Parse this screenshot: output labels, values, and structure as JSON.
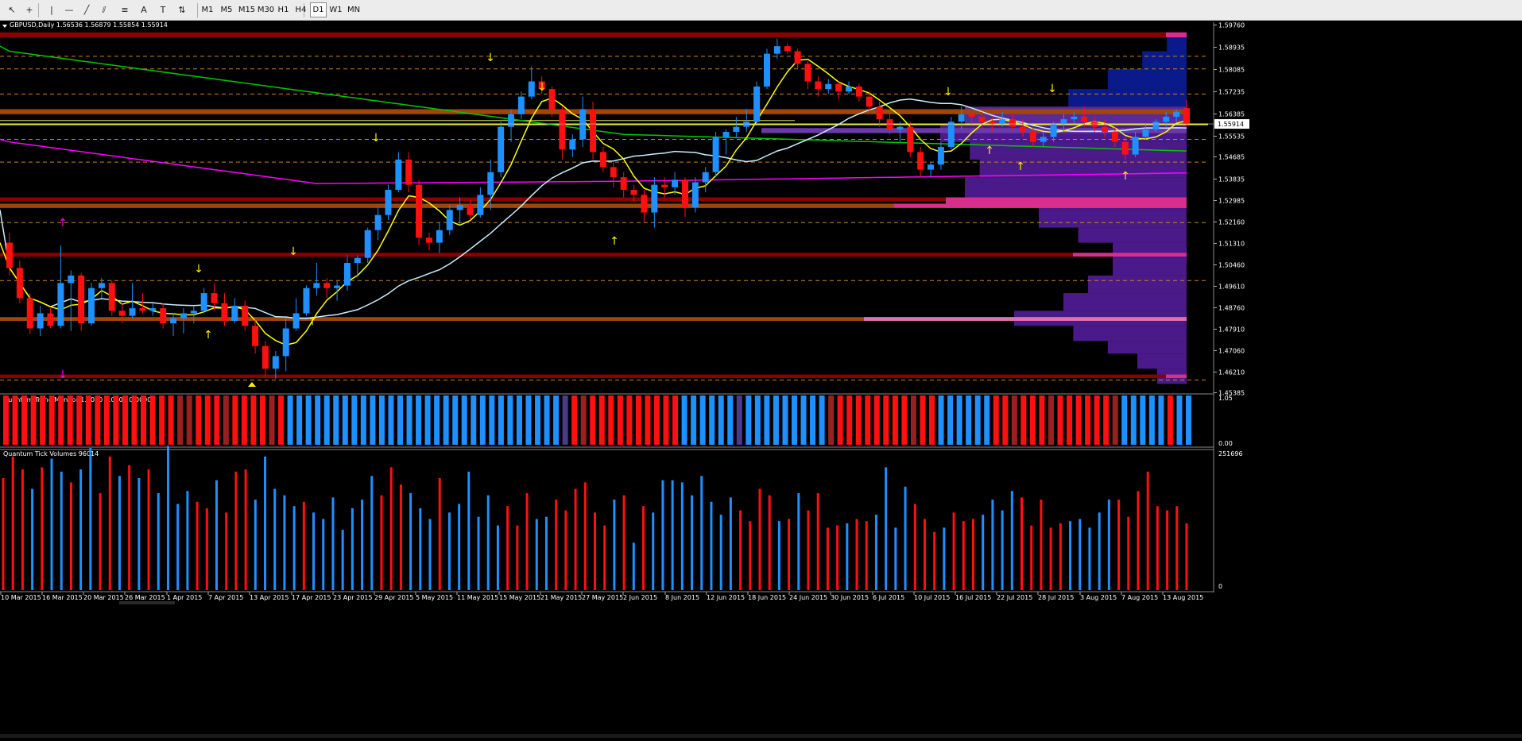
{
  "toolbar": {
    "tools": [
      {
        "name": "cursor-icon",
        "glyph": "↖"
      },
      {
        "name": "crosshair-icon",
        "glyph": "+"
      },
      {
        "name": "vertical-line-icon",
        "glyph": "|"
      },
      {
        "name": "horizontal-line-icon",
        "glyph": "—"
      },
      {
        "name": "trendline-icon",
        "glyph": "╱"
      },
      {
        "name": "equidistant-channel-icon",
        "glyph": "⫽"
      },
      {
        "name": "fibonacci-icon",
        "glyph": "≡"
      },
      {
        "name": "text-icon",
        "glyph": "A"
      },
      {
        "name": "text-label-icon",
        "glyph": "T"
      },
      {
        "name": "arrows-icon",
        "glyph": "⇅"
      }
    ],
    "timeframes": [
      "M1",
      "M5",
      "M15",
      "M30",
      "H1",
      "H4",
      "D1",
      "W1",
      "MN"
    ],
    "active_timeframe": "D1"
  },
  "main_chart": {
    "title": "GBPUSD,Daily  1.56536 1.56879 1.55854 1.55914",
    "current_price": "1.55914",
    "price_labels": [
      "1.59760",
      "1.58935",
      "1.58085",
      "1.57235",
      "1.56385",
      "1.55535",
      "1.54685",
      "1.53835",
      "1.52985",
      "1.52160",
      "1.51310",
      "1.50460",
      "1.49610",
      "1.48760",
      "1.47910",
      "1.47060",
      "1.46210",
      "1.45385"
    ]
  },
  "trend_monitor": {
    "title": "Quantum Trend Monitor 1.0000 0.0000 0.0000",
    "scale_top": "1.05",
    "scale_bottom": "0.00"
  },
  "tick_volumes": {
    "title": "Quantum Tick Volumes 96014",
    "scale_top": "251696",
    "scale_bottom": "0"
  },
  "date_labels": [
    "10 Mar 2015",
    "16 Mar 2015",
    "20 Mar 2015",
    "26 Mar 2015",
    "1 Apr 2015",
    "7 Apr 2015",
    "13 Apr 2015",
    "17 Apr 2015",
    "23 Apr 2015",
    "29 Apr 2015",
    "5 May 2015",
    "11 May 2015",
    "15 May 2015",
    "21 May 2015",
    "27 May 2015",
    "2 Jun 2015",
    "8 Jun 2015",
    "12 Jun 2015",
    "18 Jun 2015",
    "24 Jun 2015",
    "30 Jun 2015",
    "6 Jul 2015",
    "10 Jul 2015",
    "16 Jul 2015",
    "22 Jul 2015",
    "28 Jul 2015",
    "3 Aug 2015",
    "7 Aug 2015",
    "13 Aug 2015"
  ],
  "colors": {
    "bull": "#1e90ff",
    "bear": "#ff1010",
    "dark_red_zone": "#8b0000",
    "orange_zone": "#a0460a",
    "yellow_line": "#ffff00",
    "green_ma": "#00c800",
    "magenta_ma": "#ff00ff",
    "light_blue_ma": "#c8f0ff",
    "profile_purple": "#4b1a8a",
    "profile_blue": "#0a1a8a",
    "profile_pink": "#d82e8c"
  },
  "candles": [
    [
      1.512,
      1.516,
      1.499,
      1.502
    ],
    [
      1.502,
      1.505,
      1.488,
      1.49
    ],
    [
      1.49,
      1.492,
      1.476,
      1.478
    ],
    [
      1.478,
      1.487,
      1.475,
      1.484
    ],
    [
      1.484,
      1.486,
      1.478,
      1.479
    ],
    [
      1.479,
      1.511,
      1.478,
      1.496
    ],
    [
      1.496,
      1.501,
      1.477,
      1.499
    ],
    [
      1.499,
      1.5,
      1.477,
      1.48
    ],
    [
      1.48,
      1.496,
      1.479,
      1.494
    ],
    [
      1.494,
      1.498,
      1.49,
      1.496
    ],
    [
      1.496,
      1.497,
      1.483,
      1.485
    ],
    [
      1.485,
      1.488,
      1.48,
      1.483
    ],
    [
      1.483,
      1.496,
      1.482,
      1.486
    ],
    [
      1.486,
      1.492,
      1.484,
      1.485
    ],
    [
      1.485,
      1.488,
      1.483,
      1.486
    ],
    [
      1.486,
      1.488,
      1.478,
      1.48
    ],
    [
      1.48,
      1.484,
      1.475,
      1.482
    ],
    [
      1.482,
      1.486,
      1.476,
      1.484
    ],
    [
      1.484,
      1.487,
      1.48,
      1.485
    ],
    [
      1.485,
      1.494,
      1.484,
      1.492
    ],
    [
      1.492,
      1.496,
      1.485,
      1.488
    ],
    [
      1.488,
      1.492,
      1.479,
      1.481
    ],
    [
      1.481,
      1.49,
      1.48,
      1.487
    ],
    [
      1.487,
      1.489,
      1.477,
      1.479
    ],
    [
      1.479,
      1.482,
      1.468,
      1.471
    ],
    [
      1.471,
      1.473,
      1.459,
      1.462
    ],
    [
      1.462,
      1.469,
      1.458,
      1.467
    ],
    [
      1.467,
      1.482,
      1.461,
      1.478
    ],
    [
      1.478,
      1.49,
      1.477,
      1.484
    ],
    [
      1.484,
      1.495,
      1.483,
      1.494
    ],
    [
      1.494,
      1.504,
      1.491,
      1.496
    ],
    [
      1.496,
      1.498,
      1.49,
      1.494
    ],
    [
      1.494,
      1.497,
      1.489,
      1.495
    ],
    [
      1.495,
      1.507,
      1.493,
      1.504
    ],
    [
      1.504,
      1.507,
      1.499,
      1.506
    ],
    [
      1.506,
      1.518,
      1.504,
      1.517
    ],
    [
      1.517,
      1.526,
      1.513,
      1.523
    ],
    [
      1.523,
      1.535,
      1.521,
      1.533
    ],
    [
      1.533,
      1.548,
      1.532,
      1.545
    ],
    [
      1.545,
      1.548,
      1.532,
      1.535
    ],
    [
      1.535,
      1.537,
      1.511,
      1.514
    ],
    [
      1.514,
      1.516,
      1.509,
      1.512
    ],
    [
      1.512,
      1.52,
      1.508,
      1.517
    ],
    [
      1.517,
      1.527,
      1.515,
      1.525
    ],
    [
      1.525,
      1.53,
      1.519,
      1.527
    ],
    [
      1.527,
      1.529,
      1.521,
      1.523
    ],
    [
      1.523,
      1.534,
      1.522,
      1.531
    ],
    [
      1.531,
      1.545,
      1.525,
      1.54
    ],
    [
      1.54,
      1.56,
      1.538,
      1.558
    ],
    [
      1.558,
      1.565,
      1.552,
      1.563
    ],
    [
      1.563,
      1.572,
      1.561,
      1.57
    ],
    [
      1.57,
      1.582,
      1.569,
      1.576
    ],
    [
      1.576,
      1.578,
      1.571,
      1.573
    ],
    [
      1.573,
      1.574,
      1.562,
      1.565
    ],
    [
      1.565,
      1.566,
      1.545,
      1.549
    ],
    [
      1.549,
      1.555,
      1.546,
      1.553
    ],
    [
      1.553,
      1.57,
      1.55,
      1.565
    ],
    [
      1.565,
      1.568,
      1.545,
      1.548
    ],
    [
      1.548,
      1.55,
      1.54,
      1.542
    ],
    [
      1.542,
      1.544,
      1.534,
      1.538
    ],
    [
      1.538,
      1.54,
      1.53,
      1.533
    ],
    [
      1.533,
      1.535,
      1.528,
      1.531
    ],
    [
      1.531,
      1.533,
      1.52,
      1.524
    ],
    [
      1.524,
      1.538,
      1.518,
      1.535
    ],
    [
      1.535,
      1.538,
      1.53,
      1.534
    ],
    [
      1.534,
      1.54,
      1.531,
      1.537
    ],
    [
      1.537,
      1.538,
      1.522,
      1.526
    ],
    [
      1.526,
      1.538,
      1.524,
      1.536
    ],
    [
      1.536,
      1.542,
      1.532,
      1.54
    ],
    [
      1.54,
      1.556,
      1.538,
      1.554
    ],
    [
      1.554,
      1.557,
      1.547,
      1.556
    ],
    [
      1.556,
      1.562,
      1.554,
      1.558
    ],
    [
      1.558,
      1.565,
      1.556,
      1.56
    ],
    [
      1.56,
      1.576,
      1.559,
      1.574
    ],
    [
      1.574,
      1.589,
      1.573,
      1.587
    ],
    [
      1.587,
      1.593,
      1.585,
      1.59
    ],
    [
      1.59,
      1.591,
      1.587,
      1.588
    ],
    [
      1.588,
      1.589,
      1.581,
      1.583
    ],
    [
      1.583,
      1.584,
      1.573,
      1.576
    ],
    [
      1.576,
      1.578,
      1.57,
      1.573
    ],
    [
      1.573,
      1.577,
      1.571,
      1.575
    ],
    [
      1.575,
      1.576,
      1.569,
      1.572
    ],
    [
      1.572,
      1.576,
      1.571,
      1.574
    ],
    [
      1.574,
      1.575,
      1.568,
      1.57
    ],
    [
      1.57,
      1.572,
      1.564,
      1.566
    ],
    [
      1.566,
      1.568,
      1.558,
      1.561
    ],
    [
      1.561,
      1.563,
      1.555,
      1.557
    ],
    [
      1.557,
      1.56,
      1.552,
      1.558
    ],
    [
      1.558,
      1.56,
      1.546,
      1.548
    ],
    [
      1.548,
      1.55,
      1.538,
      1.541
    ],
    [
      1.541,
      1.544,
      1.538,
      1.543
    ],
    [
      1.543,
      1.552,
      1.541,
      1.55
    ],
    [
      1.55,
      1.562,
      1.549,
      1.56
    ],
    [
      1.56,
      1.566,
      1.557,
      1.563
    ],
    [
      1.563,
      1.565,
      1.559,
      1.562
    ],
    [
      1.562,
      1.564,
      1.557,
      1.56
    ],
    [
      1.56,
      1.562,
      1.556,
      1.559
    ],
    [
      1.559,
      1.564,
      1.558,
      1.561
    ],
    [
      1.561,
      1.563,
      1.556,
      1.558
    ],
    [
      1.558,
      1.561,
      1.554,
      1.556
    ],
    [
      1.556,
      1.558,
      1.55,
      1.552
    ],
    [
      1.552,
      1.556,
      1.55,
      1.554
    ],
    [
      1.554,
      1.56,
      1.552,
      1.559
    ],
    [
      1.559,
      1.563,
      1.556,
      1.561
    ],
    [
      1.561,
      1.564,
      1.559,
      1.562
    ],
    [
      1.562,
      1.566,
      1.558,
      1.56
    ],
    [
      1.56,
      1.562,
      1.556,
      1.558
    ],
    [
      1.558,
      1.561,
      1.554,
      1.556
    ],
    [
      1.556,
      1.558,
      1.55,
      1.552
    ],
    [
      1.552,
      1.554,
      1.545,
      1.547
    ],
    [
      1.547,
      1.556,
      1.546,
      1.554
    ],
    [
      1.554,
      1.559,
      1.553,
      1.557
    ],
    [
      1.557,
      1.561,
      1.556,
      1.56
    ],
    [
      1.56,
      1.564,
      1.558,
      1.562
    ],
    [
      1.562,
      1.565,
      1.56,
      1.564
    ],
    [
      1.5654,
      1.5688,
      1.5585,
      1.5591
    ]
  ],
  "trend_bars": [
    1,
    1,
    1,
    1,
    1,
    1,
    1,
    1,
    1,
    1,
    1,
    1,
    1,
    1,
    1,
    1,
    1,
    1,
    1,
    2,
    2,
    1,
    1,
    1,
    2,
    1,
    1,
    1,
    1,
    2,
    1,
    0,
    0,
    0,
    0,
    0,
    0,
    0,
    0,
    0,
    0,
    0,
    0,
    0,
    0,
    0,
    0,
    0,
    0,
    0,
    0,
    0,
    0,
    0,
    0,
    0,
    0,
    0,
    0,
    0,
    0,
    3,
    1,
    2,
    1,
    1,
    1,
    1,
    1,
    1,
    1,
    1,
    1,
    1,
    0,
    0,
    0,
    0,
    0,
    0,
    3,
    0,
    0,
    0,
    0,
    0,
    0,
    0,
    0,
    0,
    2,
    1,
    1,
    1,
    1,
    1,
    1,
    1,
    1,
    2,
    1,
    1,
    0,
    0,
    0,
    0,
    0,
    0,
    1,
    1,
    2,
    1,
    1,
    1,
    2,
    1,
    1,
    1,
    1,
    1,
    1,
    2,
    0,
    0,
    0,
    0,
    0,
    1,
    0,
    0
  ],
  "volumes": [
    0.52,
    0.62,
    0.56,
    0.47,
    0.57,
    0.61,
    0.55,
    0.5,
    0.56,
    0.66,
    0.45,
    0.62,
    0.53,
    0.58,
    0.52,
    0.56,
    0.45,
    0.67,
    0.4,
    0.46,
    0.41,
    0.38,
    0.51,
    0.36,
    0.55,
    0.56,
    0.42,
    0.62,
    0.47,
    0.44,
    0.39,
    0.41,
    0.36,
    0.33,
    0.43,
    0.28,
    0.38,
    0.42,
    0.53,
    0.44,
    0.57,
    0.49,
    0.45,
    0.38,
    0.33,
    0.52,
    0.36,
    0.4,
    0.55,
    0.34,
    0.44,
    0.3,
    0.39,
    0.3,
    0.45,
    0.33,
    0.34,
    0.42,
    0.37,
    0.47,
    0.5,
    0.36,
    0.3,
    0.42,
    0.44,
    0.22,
    0.39,
    0.36,
    0.51,
    0.51,
    0.5,
    0.44,
    0.53,
    0.41,
    0.35,
    0.43,
    0.37,
    0.32,
    0.47,
    0.44,
    0.32,
    0.33,
    0.45,
    0.37,
    0.45,
    0.29,
    0.3,
    0.31,
    0.33,
    0.32,
    0.35,
    0.57,
    0.29,
    0.48,
    0.4,
    0.33,
    0.27,
    0.29,
    0.36,
    0.32,
    0.33,
    0.35,
    0.42,
    0.37,
    0.46,
    0.43,
    0.3,
    0.42,
    0.29,
    0.31,
    0.32,
    0.33,
    0.29,
    0.36,
    0.42,
    0.42,
    0.34,
    0.46,
    0.55,
    0.39,
    0.37,
    0.39,
    0.31
  ]
}
